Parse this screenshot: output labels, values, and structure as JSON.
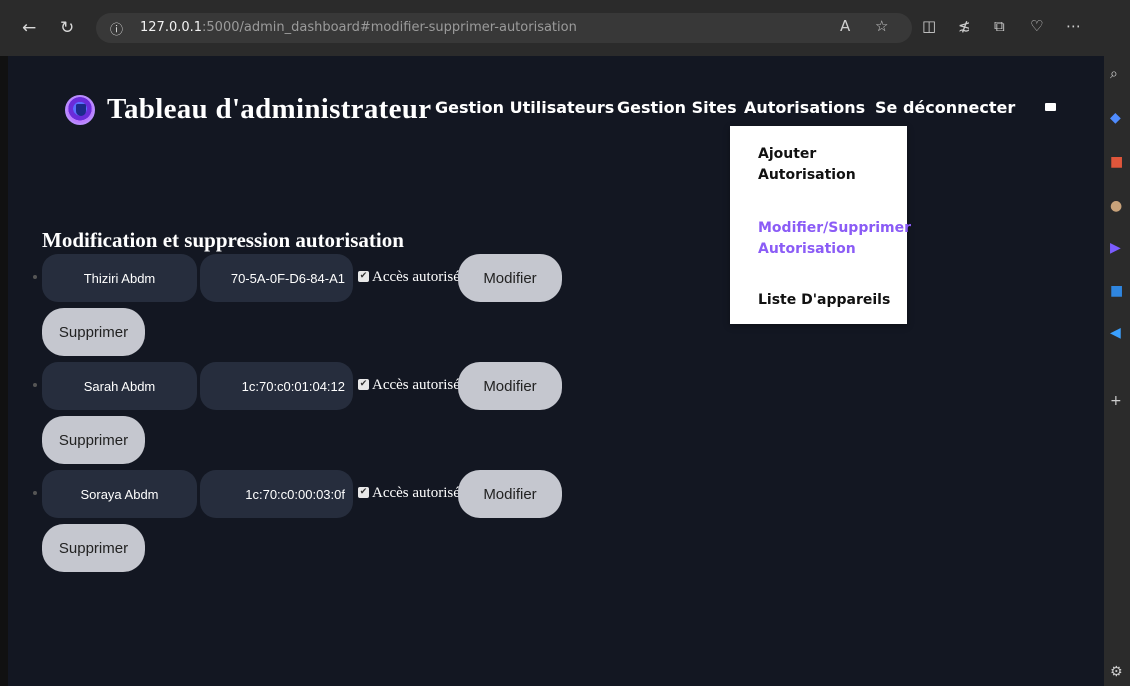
{
  "browser": {
    "url_host": "127.0.0.1",
    "url_path": ":5000/admin_dashboard#modifier-supprimer-autorisation",
    "icons": [
      "back-icon",
      "refresh-icon",
      "info-icon",
      "read-aloud-icon",
      "favorite-star-icon",
      "split-screen-icon",
      "favorites-icon",
      "collections-icon",
      "health-icon",
      "more-icon",
      "copilot-icon"
    ],
    "sidebar_icons": [
      "search-icon",
      "tag-icon",
      "briefcase-icon",
      "people-icon",
      "games-icon",
      "outlook-icon",
      "telegram-icon",
      "add-icon",
      "settings-icon"
    ]
  },
  "header": {
    "title": "Tableau d'administrateur",
    "nav": [
      {
        "label": "Gestion Utilisateurs"
      },
      {
        "label": "Gestion Sites"
      },
      {
        "label": "Autorisations"
      },
      {
        "label": "Se déconnecter"
      }
    ]
  },
  "dropdown": {
    "items": [
      {
        "label_line1": "Ajouter",
        "label_line2": "Autorisation",
        "active": false
      },
      {
        "label_line1": "Modifier/Supprimer",
        "label_line2": "Autorisation",
        "active": true
      },
      {
        "label_line1": "Liste D'appareils",
        "label_line2": "",
        "active": false
      }
    ]
  },
  "section": {
    "title": "Modification et suppression autorisation"
  },
  "authorizations": [
    {
      "name": "Thiziri Abdm",
      "mac": "70-5A-0F-D6-84-A1",
      "access_label": "Accès autorisé",
      "checked": true,
      "modify_label": "Modifier",
      "delete_label": "Supprimer"
    },
    {
      "name": "Sarah Abdm",
      "mac": "1c:70:c0:01:04:12",
      "access_label": "Accès autorisé",
      "checked": true,
      "modify_label": "Modifier",
      "delete_label": "Supprimer"
    },
    {
      "name": "Soraya Abdm",
      "mac": "1c:70:c0:00:03:0f",
      "access_label": "Accès autorisé",
      "checked": true,
      "modify_label": "Modifier",
      "delete_label": "Supprimer"
    }
  ],
  "colors": {
    "page_bg": "#131722",
    "pill_bg": "#262d3d",
    "button_bg": "#c5c7cf",
    "dropdown_active": "#8b5cf6"
  }
}
